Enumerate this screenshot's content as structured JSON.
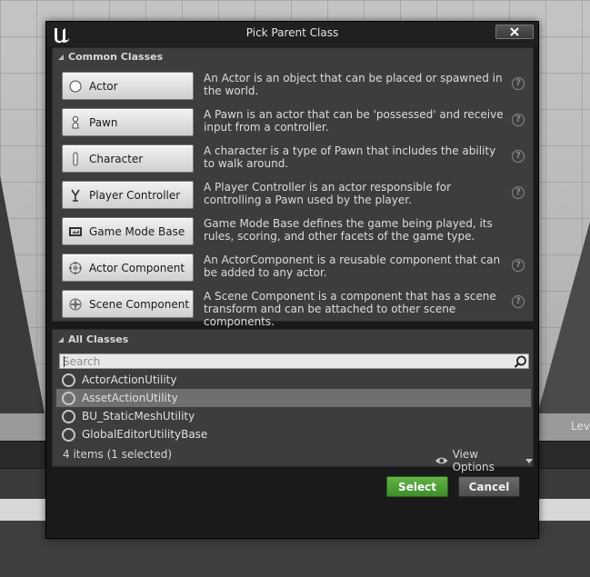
{
  "dialog": {
    "title": "Pick Parent Class",
    "close_icon": "close-icon"
  },
  "common_classes": {
    "header": "Common Classes",
    "items": [
      {
        "name": "Actor",
        "description": "An Actor is an object that can be placed or spawned in the world.",
        "icon": "sphere-icon",
        "help": true
      },
      {
        "name": "Pawn",
        "description": "A Pawn is an actor that can be 'possessed' and receive input from a controller.",
        "icon": "pawn-icon",
        "help": true
      },
      {
        "name": "Character",
        "description": "A character is a type of Pawn that includes the ability to walk around.",
        "icon": "character-icon",
        "help": true
      },
      {
        "name": "Player Controller",
        "description": "A Player Controller is an actor responsible for controlling a Pawn used by the player.",
        "icon": "controller-icon",
        "help": true
      },
      {
        "name": "Game Mode Base",
        "description": "Game Mode Base defines the game being played, its rules, scoring, and other facets of the game type.",
        "icon": "game-mode-icon",
        "help": false
      },
      {
        "name": "Actor Component",
        "description": "An ActorComponent is a reusable component that can be added to any actor.",
        "icon": "component-icon",
        "help": true
      },
      {
        "name": "Scene Component",
        "description": "A Scene Component is a component that has a scene transform and can be attached to other scene components.",
        "icon": "scene-component-icon",
        "help": true
      }
    ]
  },
  "all_classes": {
    "header": "All Classes",
    "search_placeholder": "Search",
    "items": [
      {
        "label": "ActorActionUtility",
        "selected": false
      },
      {
        "label": "AssetActionUtility",
        "selected": true
      },
      {
        "label": "BU_StaticMeshUtility",
        "selected": false
      },
      {
        "label": "GlobalEditorUtilityBase",
        "selected": false
      }
    ],
    "status": "4 items (1 selected)",
    "view_options": "View Options"
  },
  "buttons": {
    "select": "Select",
    "cancel": "Cancel"
  },
  "viewport": {
    "corner_text": "Lev"
  },
  "colors": {
    "select_green": "#4c9f34",
    "selected_row": "#6f6f6f",
    "panel_bg": "#3d3d3d",
    "dialog_bg": "#1a1a1a"
  }
}
